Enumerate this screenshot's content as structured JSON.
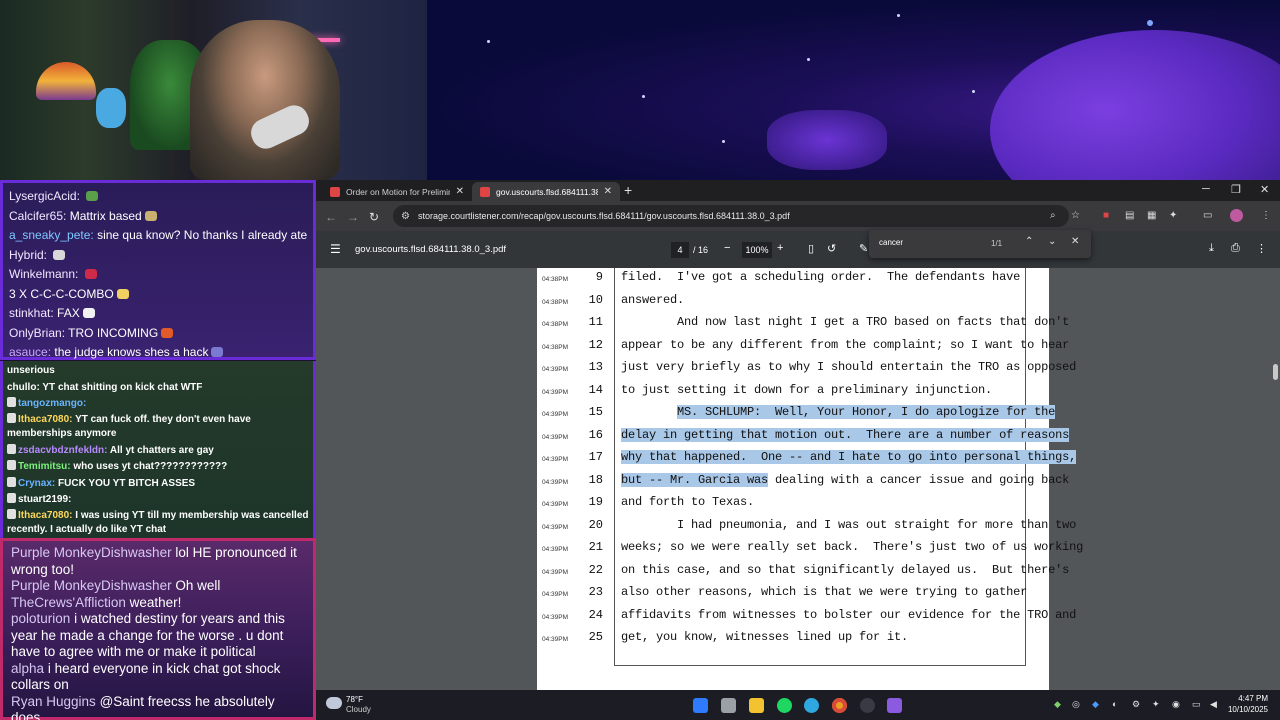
{
  "chat_top": [
    {
      "user": "LysergicAcid:",
      "text": "",
      "user_class": "user"
    },
    {
      "user": "Calcifer65:",
      "text": "Mattrix based",
      "user_class": "user"
    },
    {
      "user": "a_sneaky_pete:",
      "text": "sine qua know? No thanks I already ate",
      "user_class": "u-blue"
    },
    {
      "user": "Hybrid:",
      "text": "",
      "user_class": "user"
    },
    {
      "user": "Winkelmann:",
      "text": "",
      "user_class": "user"
    },
    {
      "user": "",
      "text": "3 X C-C-C-COMBO",
      "user_class": "user"
    },
    {
      "user": "stinkhat:",
      "text": "FAX",
      "user_class": "user"
    },
    {
      "user": "OnlyBrian:",
      "text": "TRO INCOMING",
      "user_class": "user"
    },
    {
      "user": "asauce:",
      "text": "the judge knows shes a hack",
      "user_class": "u-purple"
    }
  ],
  "chat_mid": [
    {
      "user": "unserious",
      "text": "",
      "user_class": "",
      "wrap": false
    },
    {
      "user": "chullo:",
      "text": "YT chat shitting on kick chat  WTF",
      "user_class": "",
      "wrap": false
    },
    {
      "user": "tangozmango:",
      "text": "",
      "user_class": "c-blue",
      "wrap": false
    },
    {
      "user": "Ithaca7080:",
      "text": "YT can fuck off. they don't even have memberships anymore",
      "user_class": "c-yellow",
      "wrap": true
    },
    {
      "user": "zsdacvbdznfekldn:",
      "text": "All yt chatters are gay",
      "user_class": "c-purple",
      "wrap": false
    },
    {
      "user": "Temimitsu:",
      "text": "who  uses yt chat????????????",
      "user_class": "c-green",
      "wrap": false
    },
    {
      "user": "Crynax:",
      "text": "FUCK YOU YT BITCH ASSES",
      "user_class": "c-blue",
      "wrap": false
    },
    {
      "user": "stuart2199:",
      "text": "",
      "user_class": "",
      "wrap": false
    },
    {
      "user": "Ithaca7080:",
      "text": "I was using YT till my membership was cancelled recently. I actually do like YT chat",
      "user_class": "c-yellow",
      "wrap": true
    }
  ],
  "chat_bottom": [
    {
      "user": "Purple MonkeyDishwasher",
      "text": "lol HE pronounced it wrong too!"
    },
    {
      "user": "Purple MonkeyDishwasher",
      "text": "Oh well"
    },
    {
      "user": "TheCrews'Affliction",
      "text": "weather!"
    },
    {
      "user": "poloturion",
      "text": "i watched destiny for years and this year he made a change for the worse . u dont have to agree with me or make it political"
    },
    {
      "user": "alpha",
      "text": "i heard everyone in kick chat got shock collars on"
    },
    {
      "user": "Ryan Huggins",
      "text": "@Saint freecss he absolutely does"
    }
  ],
  "browser": {
    "tabs": [
      {
        "title": "Order on Motion for Prelimina"
      },
      {
        "title": "gov.uscourts.flsd.684111.38.0_3"
      }
    ],
    "new_tab": "+",
    "url": "storage.courtlistener.com/recap/gov.uscourts.flsd.684111/gov.uscourts.flsd.684111.38.0_3.pdf"
  },
  "pdf": {
    "file_name": "gov.uscourts.flsd.684111.38.0_3.pdf",
    "page": "4",
    "total_pages": "/ 16",
    "zoom": "100%"
  },
  "find": {
    "query": "cancer",
    "count": "1/1"
  },
  "transcript": [
    {
      "ts": "04:38PM",
      "ln": "9",
      "pre": "filed.  I've got a scheduling order.  The defendants have",
      "hl": "",
      "post": ""
    },
    {
      "ts": "04:38PM",
      "ln": "10",
      "pre": "answered.",
      "hl": "",
      "post": ""
    },
    {
      "ts": "04:38PM",
      "ln": "11",
      "pre": "        And now last night I get a TRO based on facts that don't",
      "hl": "",
      "post": ""
    },
    {
      "ts": "04:38PM",
      "ln": "12",
      "pre": "appear to be any different from the complaint; so I want to hear",
      "hl": "",
      "post": ""
    },
    {
      "ts": "04:39PM",
      "ln": "13",
      "pre": "just very briefly as to why I should entertain the TRO as opposed",
      "hl": "",
      "post": ""
    },
    {
      "ts": "04:39PM",
      "ln": "14",
      "pre": "to just setting it down for a preliminary injunction.",
      "hl": "",
      "post": ""
    },
    {
      "ts": "04:39PM",
      "ln": "15",
      "pre": "        ",
      "hl": "MS. SCHLUMP:  Well, Your Honor, I do apologize for the",
      "post": ""
    },
    {
      "ts": "04:39PM",
      "ln": "16",
      "pre": "",
      "hl": "delay in getting that motion out.  There are a number of reasons",
      "post": ""
    },
    {
      "ts": "04:39PM",
      "ln": "17",
      "pre": "",
      "hl": "why that happened.  One -- and I hate to go into personal things,",
      "post": ""
    },
    {
      "ts": "04:39PM",
      "ln": "18",
      "pre": "",
      "hl": "but -- Mr. Garcia was",
      "post": " dealing with a cancer issue and going back"
    },
    {
      "ts": "04:39PM",
      "ln": "19",
      "pre": "and forth to Texas.",
      "hl": "",
      "post": ""
    },
    {
      "ts": "04:39PM",
      "ln": "20",
      "pre": "        I had pneumonia, and I was out straight for more than two",
      "hl": "",
      "post": ""
    },
    {
      "ts": "04:39PM",
      "ln": "21",
      "pre": "weeks; so we were really set back.  There's just two of us working",
      "hl": "",
      "post": ""
    },
    {
      "ts": "04:39PM",
      "ln": "22",
      "pre": "on this case, and so that significantly delayed us.  But there's",
      "hl": "",
      "post": ""
    },
    {
      "ts": "04:39PM",
      "ln": "23",
      "pre": "also other reasons, which is that we were trying to gather",
      "hl": "",
      "post": ""
    },
    {
      "ts": "04:39PM",
      "ln": "24",
      "pre": "affidavits from witnesses to bolster our evidence for the TRO and",
      "hl": "",
      "post": ""
    },
    {
      "ts": "04:39PM",
      "ln": "25",
      "pre": "get, you know, witnesses lined up for it.",
      "hl": "",
      "post": ""
    }
  ],
  "taskbar": {
    "temperature": "78°F",
    "condition": "Cloudy",
    "time": "4:47 PM",
    "date": "10/10/2025"
  },
  "colors": {
    "highlight": "#a9c7e6",
    "pdf_background": "#525659",
    "chat_border_purple": "#6a2bd8",
    "chat_border_pink": "#c02a6a"
  }
}
